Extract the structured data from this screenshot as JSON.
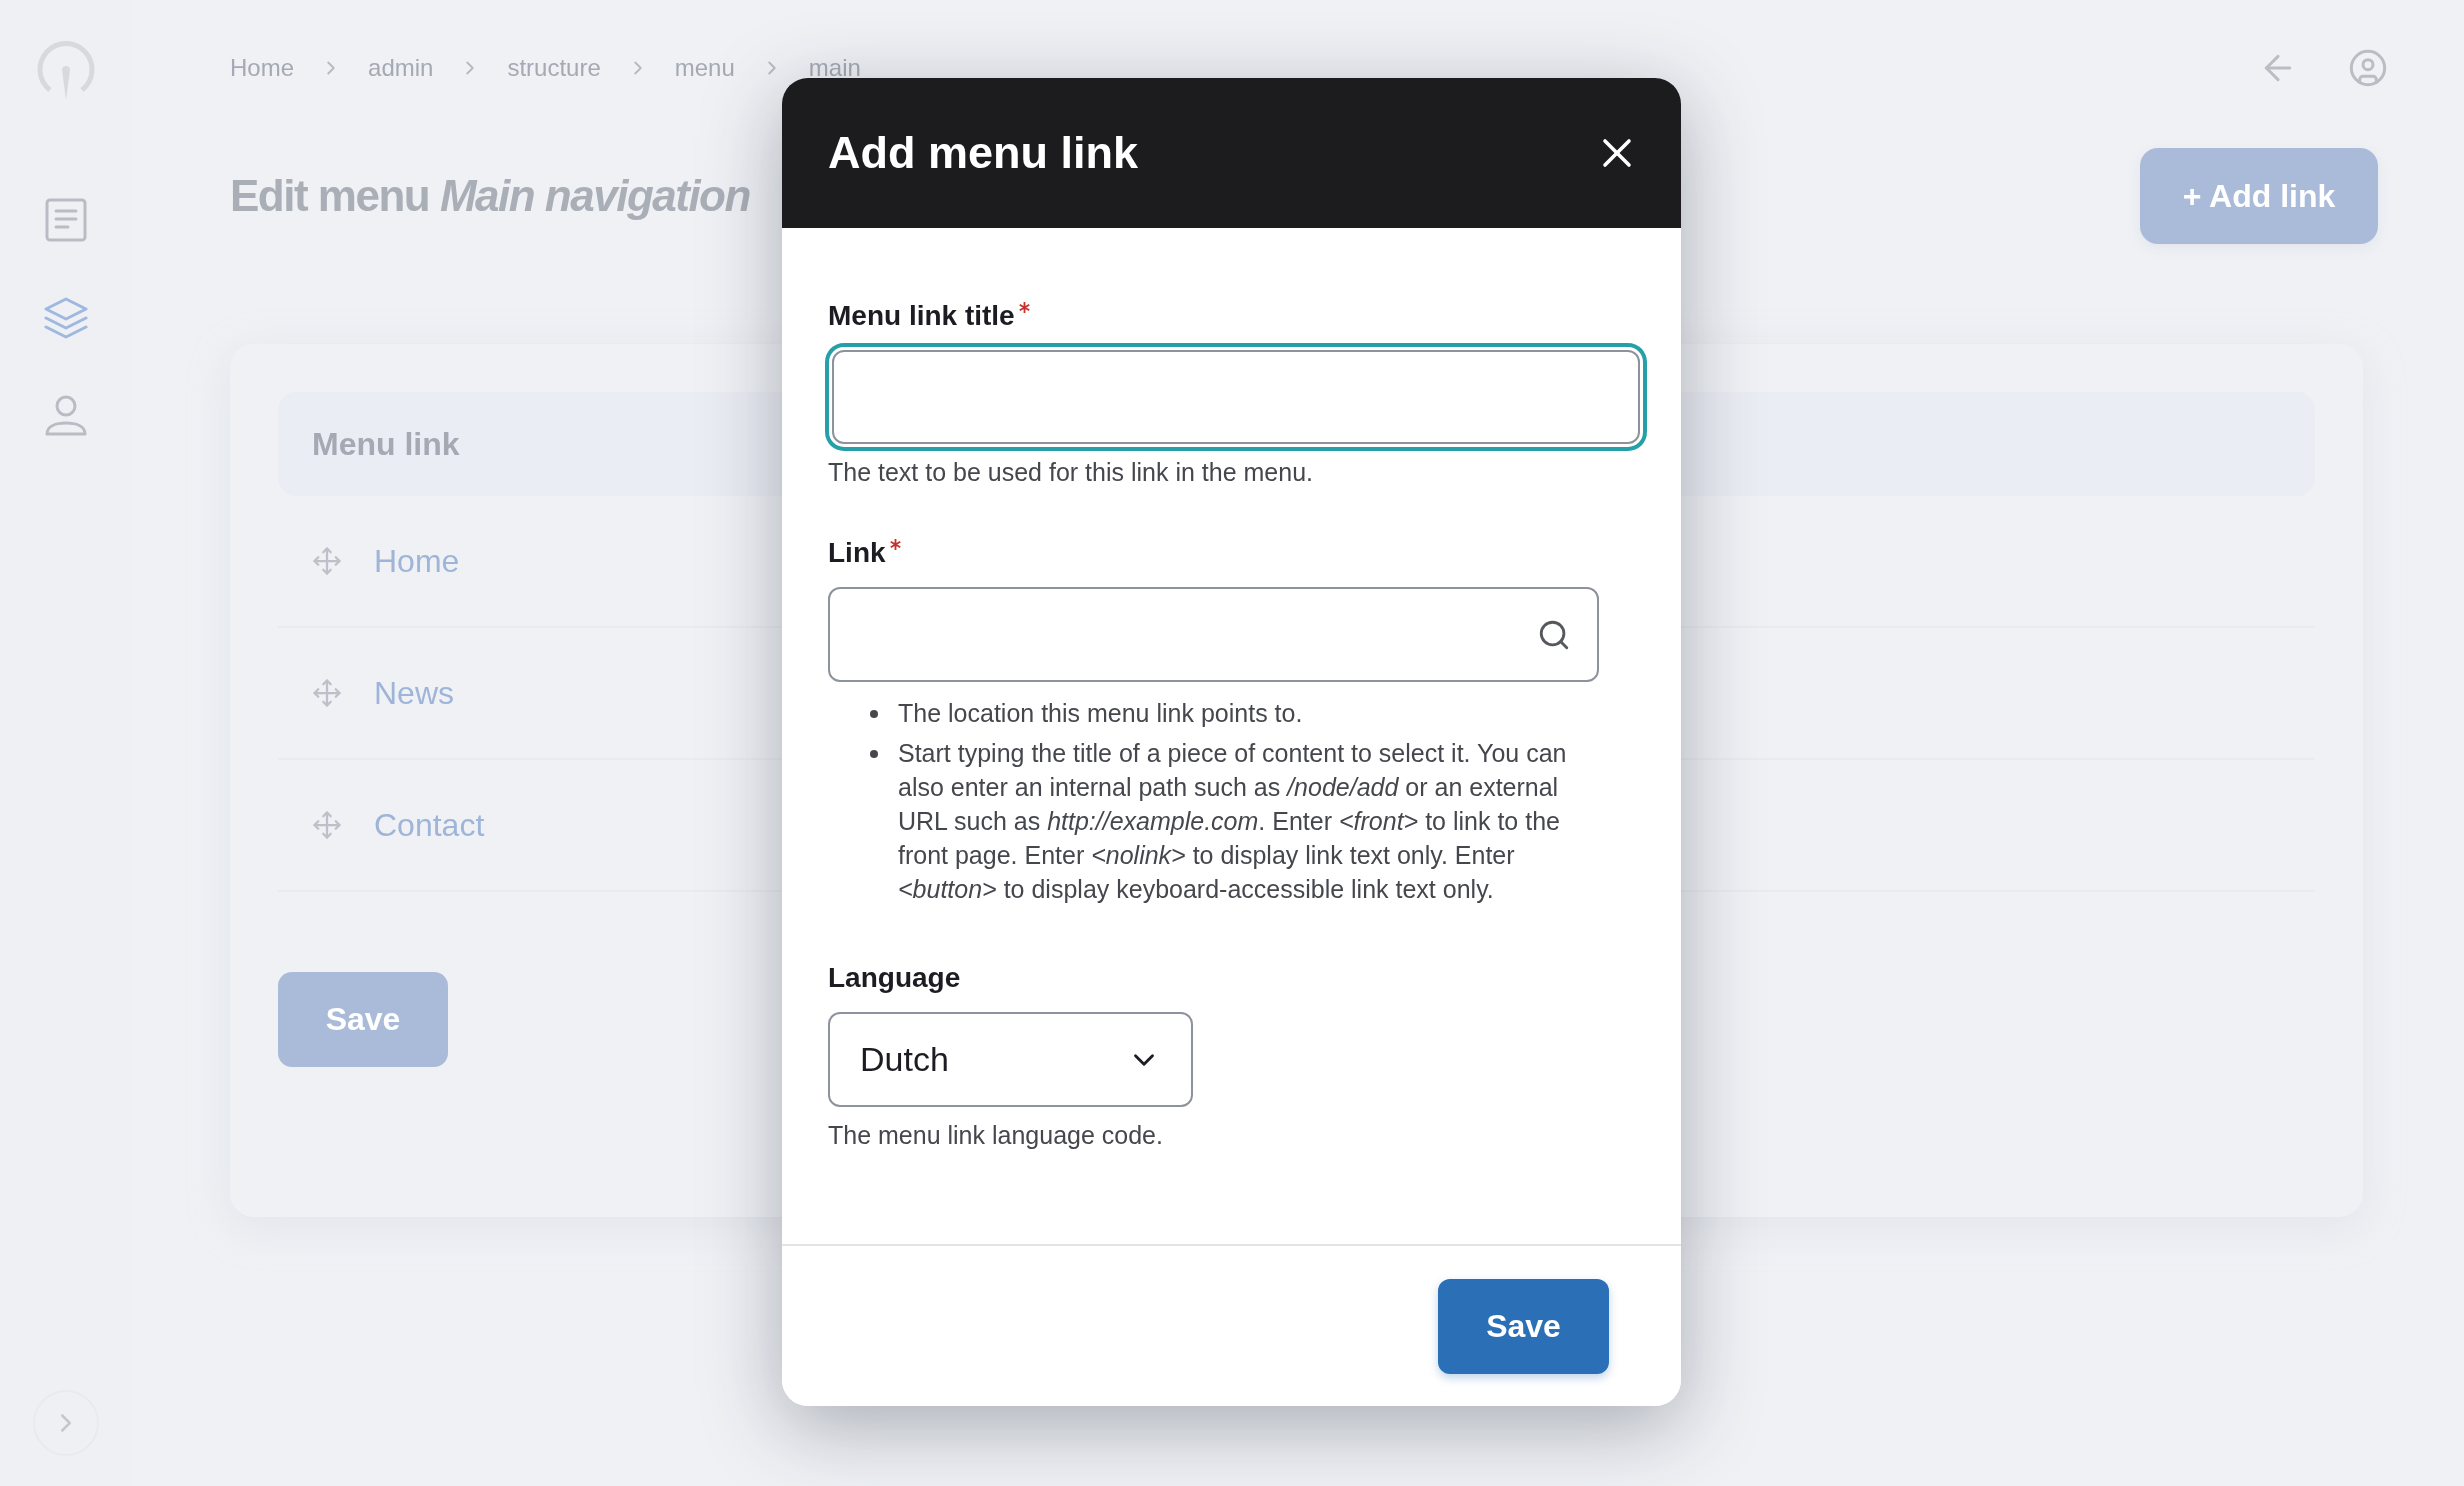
{
  "sidebar": {
    "items": [
      {
        "kind": "document",
        "selected": false
      },
      {
        "kind": "layers",
        "selected": true
      },
      {
        "kind": "user",
        "selected": false
      }
    ]
  },
  "breadcrumb": [
    "Home",
    "admin",
    "structure",
    "menu",
    "main"
  ],
  "page_title": "Edit menu *Main navigation*",
  "add_button": "+ Add link",
  "table": {
    "columns": [
      "Menu link"
    ],
    "rows": [
      "Home",
      "News",
      "Contact"
    ]
  },
  "save_button": "Save",
  "dialog": {
    "title": "Add menu link",
    "fields": [
      {
        "kind": "text",
        "label": "Menu link title",
        "required": true,
        "focused": true,
        "description": "The text to be used for this link in the menu."
      },
      {
        "kind": "search",
        "label": "Link",
        "required": true,
        "focused": false,
        "help_items": [
          "The location this menu link points to.",
          "Start typing the title of a piece of content to select it. You can also enter an internal path such as */node/add* or an external URL such as *http://example.com*. Enter *<front>* to link to the front page. Enter *<nolink>* to display link text only. Enter *<button>* to display keyboard-accessible link text only."
        ]
      },
      {
        "kind": "select",
        "label": "Language",
        "required": false,
        "focused": false,
        "value": "Dutch",
        "description": "The menu link language code."
      }
    ],
    "save_button": "Save"
  }
}
